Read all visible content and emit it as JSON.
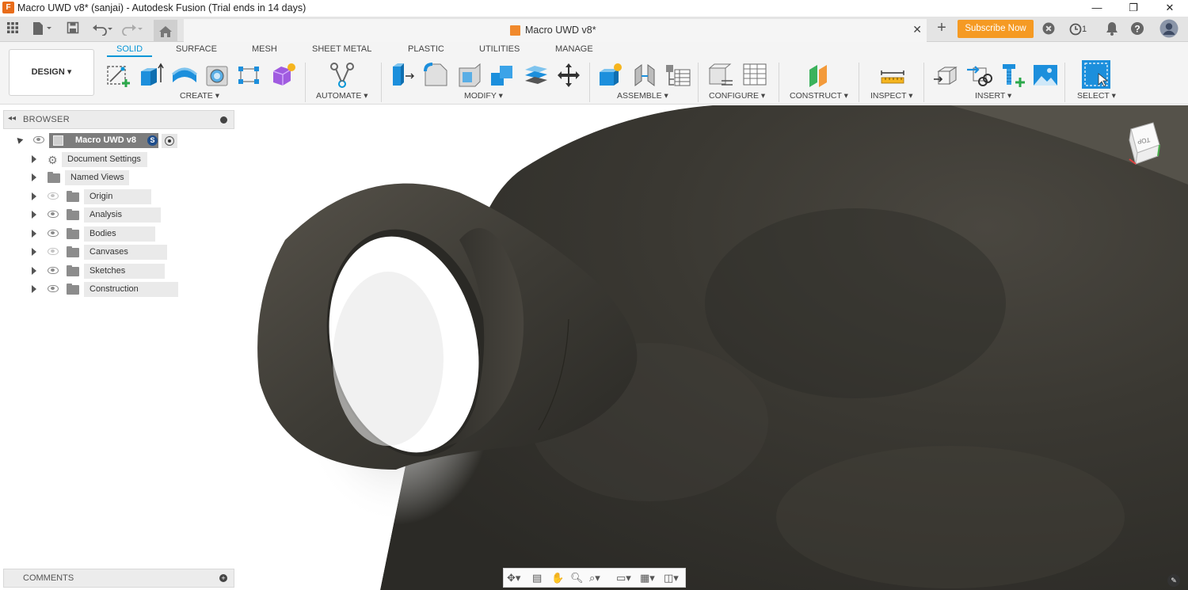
{
  "window": {
    "title": "Macro UWD v8* (sanjai) - Autodesk Fusion (Trial ends in 14 days)",
    "minimize": "—",
    "maximize": "❐",
    "close": "✕"
  },
  "quickaccess": {
    "document_tab": "Macro UWD v8*",
    "subscribe_label": "Subscribe Now",
    "job_count": "1"
  },
  "toolbar": {
    "workspace": "DESIGN",
    "tabs": [
      "SOLID",
      "SURFACE",
      "MESH",
      "SHEET METAL",
      "PLASTIC",
      "UTILITIES",
      "MANAGE"
    ],
    "active_tab": "SOLID",
    "groups": {
      "create": "CREATE",
      "automate": "AUTOMATE",
      "modify": "MODIFY",
      "assemble": "ASSEMBLE",
      "configure": "CONFIGURE",
      "construct": "CONSTRUCT",
      "inspect": "INSPECT",
      "insert": "INSERT",
      "select": "SELECT"
    },
    "accent": "#0696d7"
  },
  "browser": {
    "title": "BROWSER",
    "root": "Macro UWD v8",
    "items": [
      {
        "label": "Document Settings",
        "visible": null
      },
      {
        "label": "Named Views",
        "visible": null
      },
      {
        "label": "Origin",
        "visible": false
      },
      {
        "label": "Analysis",
        "visible": true
      },
      {
        "label": "Bodies",
        "visible": true
      },
      {
        "label": "Canvases",
        "visible": false
      },
      {
        "label": "Sketches",
        "visible": true
      },
      {
        "label": "Construction",
        "visible": true
      }
    ]
  },
  "comments": {
    "title": "COMMENTS"
  },
  "viewcube": {
    "face": "TOP"
  }
}
